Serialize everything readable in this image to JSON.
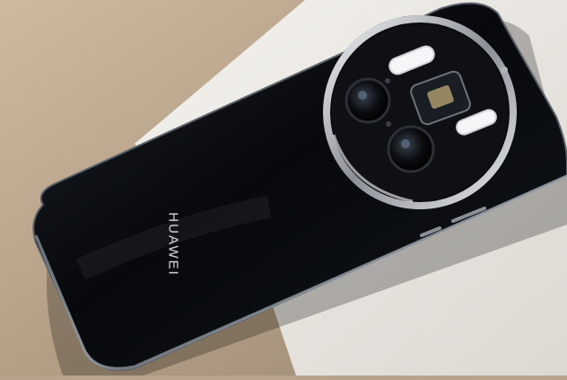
{
  "photo": {
    "subject": "smartphone-back",
    "brand_label": "HUAWEI",
    "colors": {
      "background_left": "#b9a58c",
      "surface": "#ece9e4",
      "phone_body": "#0d0f12",
      "camera_ring": "#c9ccd0"
    }
  }
}
